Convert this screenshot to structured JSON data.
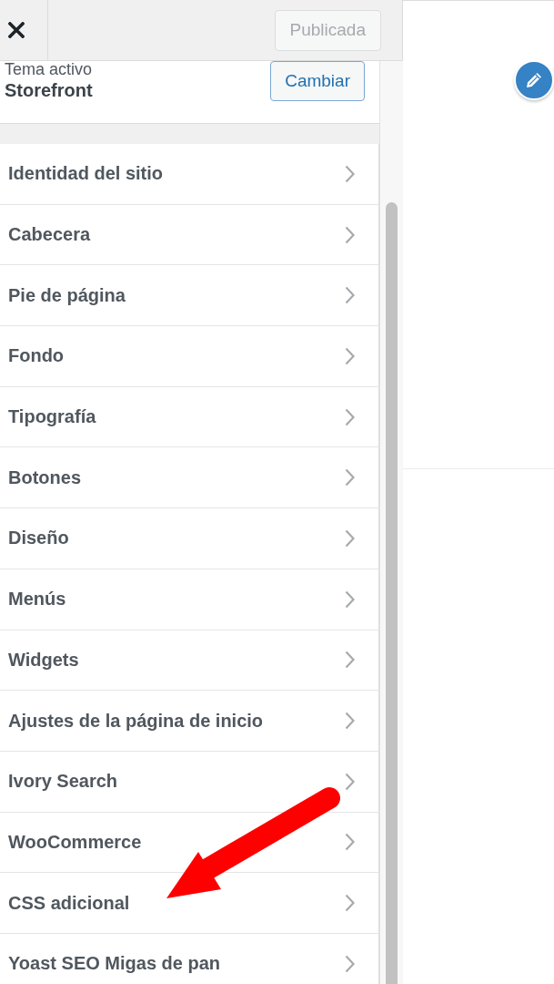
{
  "header": {
    "publish_button": {
      "label": "Publicada",
      "disabled": true
    }
  },
  "active_theme": {
    "caption": "Tema activo",
    "name": "Storefront",
    "button": "Cambiar"
  },
  "sections": [
    {
      "label": "Identidad del sitio"
    },
    {
      "label": "Cabecera"
    },
    {
      "label": "Pie de página"
    },
    {
      "label": "Fondo"
    },
    {
      "label": "Tipografía"
    },
    {
      "label": "Botones"
    },
    {
      "label": "Diseño"
    },
    {
      "label": "Menús"
    },
    {
      "label": "Widgets"
    },
    {
      "label": "Ajustes de la página de inicio"
    },
    {
      "label": "Ivory Search"
    },
    {
      "label": "WooCommerce"
    },
    {
      "label": "CSS adicional"
    },
    {
      "label": "Yoast SEO Migas de pan"
    }
  ]
}
